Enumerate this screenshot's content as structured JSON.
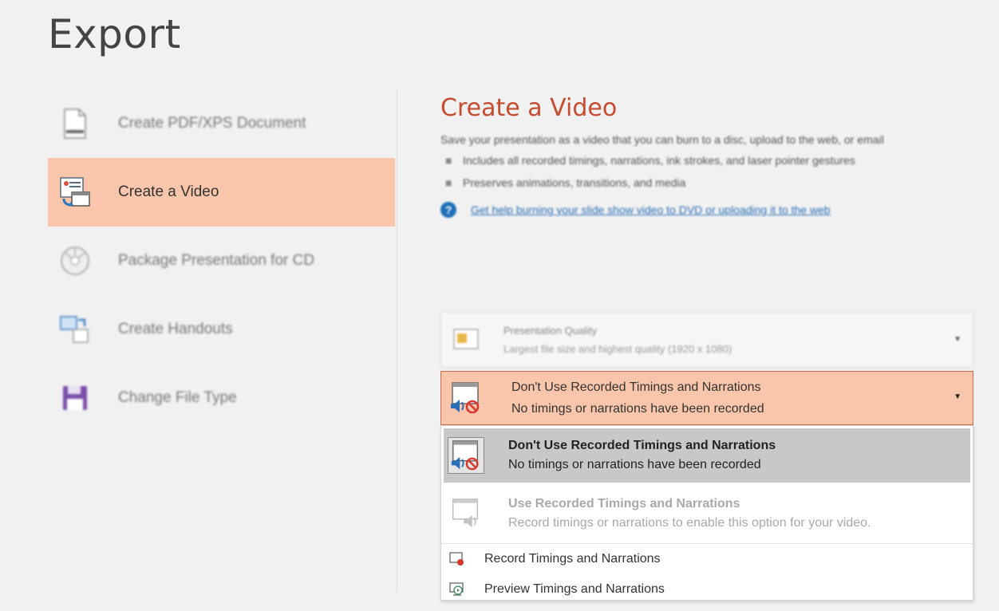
{
  "page": {
    "title": "Export"
  },
  "nav": {
    "items": [
      {
        "label": "Create PDF/XPS Document",
        "icon": "pdf-document-icon"
      },
      {
        "label": "Create a Video",
        "icon": "video-icon"
      },
      {
        "label": "Package Presentation for CD",
        "icon": "cd-icon"
      },
      {
        "label": "Create Handouts",
        "icon": "handouts-icon"
      },
      {
        "label": "Change File Type",
        "icon": "save-file-icon"
      }
    ]
  },
  "content": {
    "title": "Create a Video",
    "description": "Save your presentation as a video that you can burn to a disc, upload to the web, or email",
    "bullets": [
      "Includes all recorded timings, narrations, ink strokes, and laser pointer gestures",
      "Preserves animations, transitions, and media"
    ],
    "help_link": "Get help burning your slide show video to DVD or uploading it to the web"
  },
  "quality": {
    "title": "Presentation Quality",
    "subtitle": "Largest file size and highest quality (1920 x 1080)"
  },
  "timings": {
    "title": "Don't Use Recorded Timings and Narrations",
    "subtitle": "No timings or narrations have been recorded",
    "options": [
      {
        "title": "Don't Use Recorded Timings and Narrations",
        "subtitle": "No timings or narrations have been recorded",
        "state": "selected"
      },
      {
        "title": "Use Recorded Timings and Narrations",
        "subtitle": "Record timings or narrations to enable this option for your video.",
        "state": "disabled"
      }
    ],
    "actions": [
      {
        "label": "Record Timings and Narrations",
        "icon": "record-icon"
      },
      {
        "label": "Preview Timings and Narrations",
        "icon": "preview-icon"
      }
    ]
  },
  "colors": {
    "accent": "#c64b2f",
    "selected_bg": "#f9c6ab",
    "link": "#2a6fb6"
  }
}
